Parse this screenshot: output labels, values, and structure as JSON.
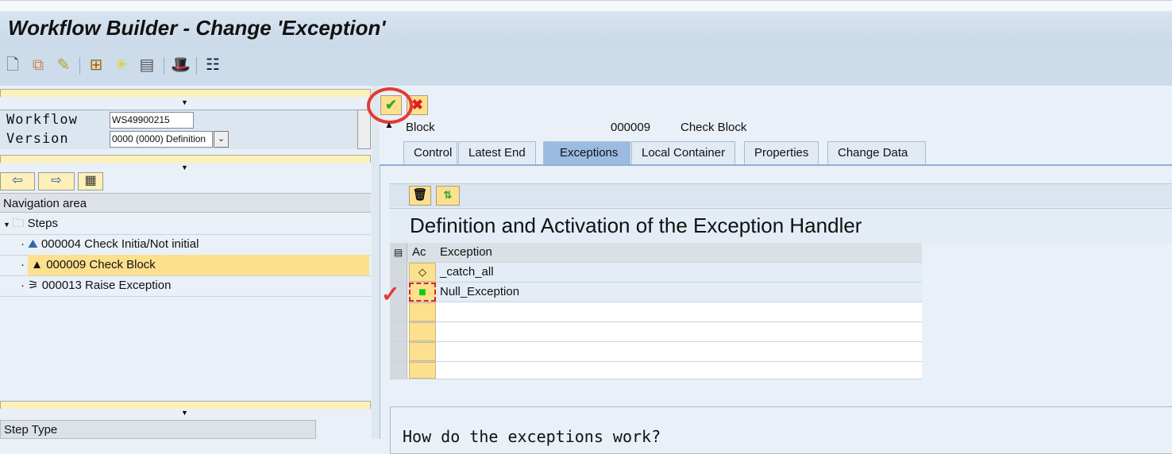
{
  "window": {
    "title": "Workflow Builder - Change 'Exception'"
  },
  "toolbar": {
    "icons": [
      "new-document-icon",
      "copy-icon",
      "edit-pencil-icon",
      "workflow-tree-icon",
      "wizard-icon",
      "display-icon",
      "hat-icon",
      "table-layout-icon"
    ]
  },
  "left": {
    "workflow_label": "Workflow",
    "workflow_value": "WS49900215",
    "version_label": "Version",
    "version_value": "0000 (0000) Definition",
    "nav_header": "Navigation area",
    "tree": [
      {
        "label": "Steps"
      },
      {
        "label": "000004 Check Initia/Not initial"
      },
      {
        "label": "000009 Check Block",
        "selected": true
      },
      {
        "label": "000013 Raise Exception"
      }
    ],
    "step_type_header": "Step Type"
  },
  "right": {
    "step_type": "Block",
    "step_number": "000009",
    "step_name": "Check Block",
    "tabs": [
      {
        "label": "Control"
      },
      {
        "label": "Latest End"
      },
      {
        "label": "Exceptions",
        "active": true
      },
      {
        "label": "Local Container"
      },
      {
        "label": "Properties"
      },
      {
        "label": "Change Data"
      }
    ],
    "heading": "Definition and Activation of the Exception Handler",
    "table": {
      "columns": [
        "Ac",
        "Exception"
      ],
      "rows": [
        {
          "icon": "diamond-icon",
          "exception": "_catch_all"
        },
        {
          "icon": "green-square-icon",
          "exception": "Null_Exception"
        }
      ],
      "empty_rows": 4
    },
    "help_text": "How do the exceptions work?"
  },
  "colors": {
    "accent": "#fde08e",
    "annotation": "#e53935"
  }
}
